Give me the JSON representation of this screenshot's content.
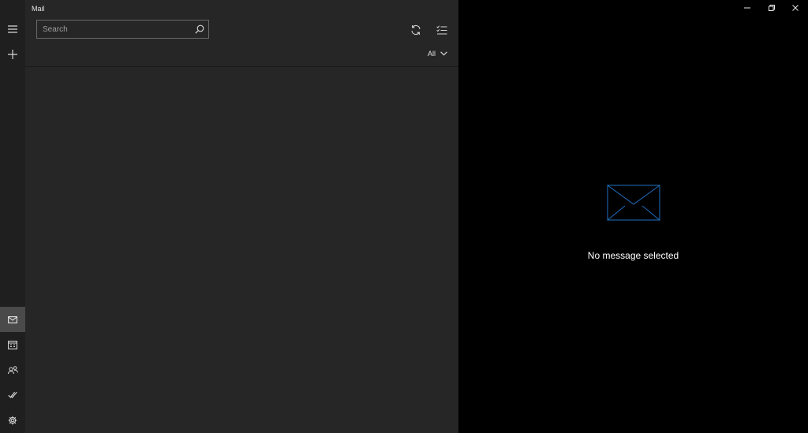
{
  "app": {
    "title": "Mail"
  },
  "search": {
    "placeholder": "Search",
    "value": ""
  },
  "toolbar": {
    "sync_icon": "sync-icon",
    "select_icon": "multi-select-icon"
  },
  "filter": {
    "label": "All",
    "icon": "chevron-down-icon"
  },
  "nav": {
    "top": [
      {
        "name": "hamburger-icon"
      },
      {
        "name": "plus-icon"
      }
    ],
    "bottom": [
      {
        "name": "mail-icon",
        "active": true
      },
      {
        "name": "calendar-icon"
      },
      {
        "name": "people-icon"
      },
      {
        "name": "todo-icon"
      },
      {
        "name": "settings-icon"
      }
    ]
  },
  "window_controls": [
    "minimize-icon",
    "restore-icon",
    "close-icon"
  ],
  "reading_pane": {
    "empty_message": "No message selected",
    "icon": "envelope-icon"
  },
  "colors": {
    "accent": "#1f6fbf",
    "list_bg": "#262626",
    "rail_bg": "#1f1f1f",
    "reading_bg": "#000000"
  }
}
